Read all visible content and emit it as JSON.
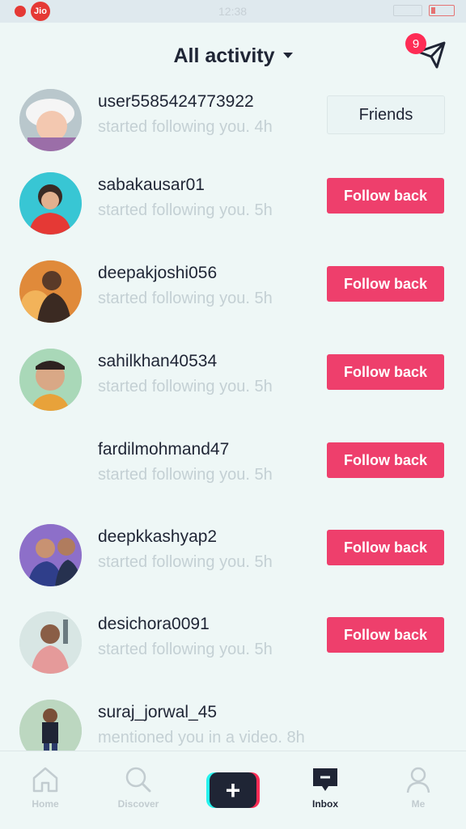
{
  "status_bar": {
    "carrier_badge": "Jio",
    "time": "12:38"
  },
  "header": {
    "title": "All activity",
    "badge_count": "9"
  },
  "activities": [
    {
      "username": "user5585424773922",
      "text": "started following you.",
      "time": "4h",
      "action": "Friends"
    },
    {
      "username": "sabakausar01",
      "text": "started following you.",
      "time": "5h",
      "action": "Follow back"
    },
    {
      "username": "deepakjoshi056",
      "text": "started following you.",
      "time": "5h",
      "action": "Follow back"
    },
    {
      "username": "sahilkhan40534",
      "text": "started following you.",
      "time": "5h",
      "action": "Follow back"
    },
    {
      "username": "fardilmohmand47",
      "text": "started following you.",
      "time": "5h",
      "action": "Follow back"
    },
    {
      "username": "deepkkashyap2",
      "text": "started following you.",
      "time": "5h",
      "action": "Follow back"
    },
    {
      "username": "desichora0091",
      "text": "started following you.",
      "time": "5h",
      "action": "Follow back"
    },
    {
      "username": "suraj_jorwal_45",
      "text": "mentioned you in a video.",
      "time": "8h"
    }
  ],
  "nav": {
    "home": "Home",
    "discover": "Discover",
    "create": "+",
    "inbox": "Inbox",
    "me": "Me"
  },
  "colors": {
    "accent": "#ee3f6c",
    "text": "#1f2535",
    "muted": "#c4d0d4",
    "background": "#eef7f6"
  }
}
